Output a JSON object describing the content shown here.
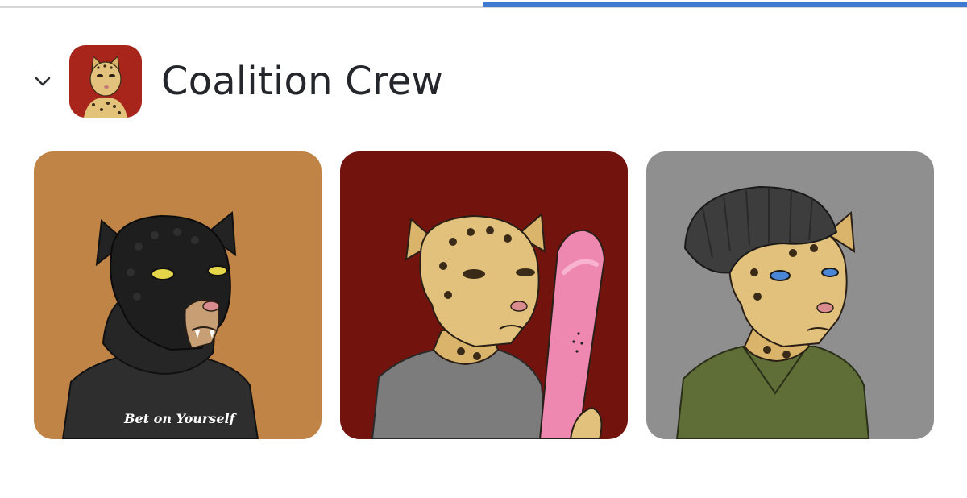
{
  "loading_bar": {
    "progress": 0.5,
    "track_color": "#d6d6d6",
    "fill_color": "#3e7bd0"
  },
  "collection": {
    "title": "Coalition Crew",
    "expand_icon": "chevron-down-icon",
    "avatar_bg": "#a7251a"
  },
  "items": [
    {
      "bg": "#c08447",
      "character": "black panther in black hoodie",
      "shirt_text": "Bet on Yourself"
    },
    {
      "bg": "#72130e",
      "character": "cheetah in grey t-shirt holding pink snowboard"
    },
    {
      "bg": "#8f8f8f",
      "character": "cheetah in grey beanie and green military shirt"
    }
  ]
}
